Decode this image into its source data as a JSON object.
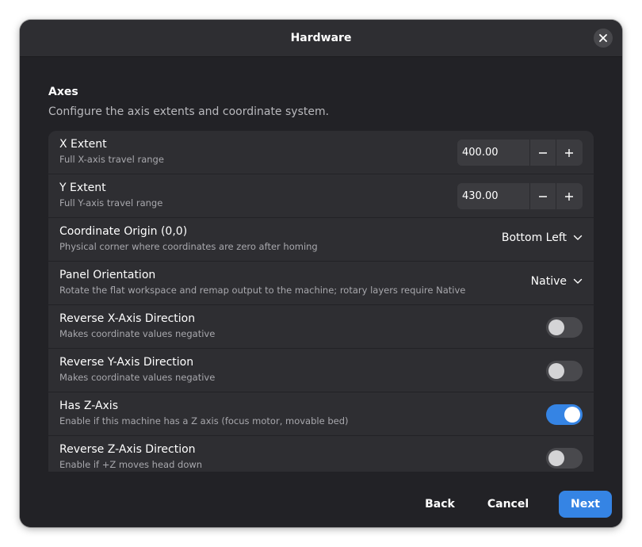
{
  "header": {
    "title": "Hardware",
    "close_icon": "close-icon"
  },
  "section": {
    "title": "Axes",
    "subtitle": "Configure the axis extents and coordinate system."
  },
  "rows": {
    "x_extent": {
      "title": "X Extent",
      "subtitle": "Full X-axis travel range",
      "value": "400.00",
      "minus_icon": "minus-icon",
      "plus_icon": "plus-icon"
    },
    "y_extent": {
      "title": "Y Extent",
      "subtitle": "Full Y-axis travel range",
      "value": "430.00",
      "minus_icon": "minus-icon",
      "plus_icon": "plus-icon"
    },
    "coordinate_origin": {
      "title": "Coordinate Origin (0,0)",
      "subtitle": "Physical corner where coordinates are zero after homing",
      "selected": "Bottom Left",
      "icon": "chevron-down-icon"
    },
    "panel_orientation": {
      "title": "Panel Orientation",
      "subtitle": "Rotate the flat workspace and remap output to the machine; rotary layers require Native",
      "selected": "Native",
      "icon": "chevron-down-icon"
    },
    "reverse_x": {
      "title": "Reverse X-Axis Direction",
      "subtitle": "Makes coordinate values negative",
      "enabled": false
    },
    "reverse_y": {
      "title": "Reverse Y-Axis Direction",
      "subtitle": "Makes coordinate values negative",
      "enabled": false
    },
    "has_z": {
      "title": "Has Z-Axis",
      "subtitle": "Enable if this machine has a Z axis (focus motor, movable bed)",
      "enabled": true
    },
    "reverse_z": {
      "title": "Reverse Z-Axis Direction",
      "subtitle": "Enable if +Z moves head down",
      "enabled": false
    }
  },
  "footer": {
    "back_label": "Back",
    "cancel_label": "Cancel",
    "next_label": "Next"
  },
  "colors": {
    "accent": "#3584e4",
    "dialog_bg": "#222226",
    "row_bg": "#2e2e32",
    "toggle_off": "#49494d"
  }
}
